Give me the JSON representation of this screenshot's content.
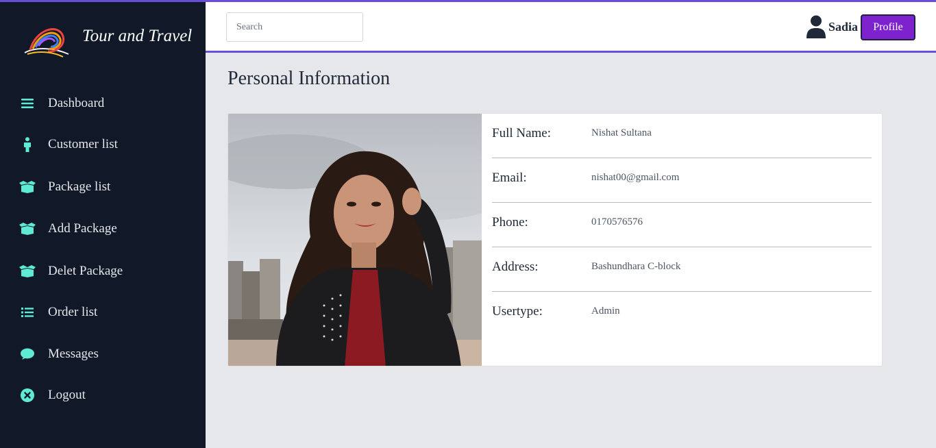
{
  "brand": {
    "title": "Tour and Travel"
  },
  "sidebar": {
    "items": [
      {
        "label": "Dashboard",
        "icon": "menu-bars-icon"
      },
      {
        "label": "Customer list",
        "icon": "person-icon"
      },
      {
        "label": "Package list",
        "icon": "box-open-icon"
      },
      {
        "label": "Add Package",
        "icon": "box-open-icon"
      },
      {
        "label": "Delet Package",
        "icon": "box-open-icon"
      },
      {
        "label": "Order list",
        "icon": "list-icon"
      },
      {
        "label": "Messages",
        "icon": "chat-bubble-icon"
      },
      {
        "label": "Logout",
        "icon": "close-circle-icon"
      }
    ]
  },
  "header": {
    "search_placeholder": "Search",
    "user_name": "Sadia",
    "profile_label": "Profile"
  },
  "main": {
    "title": "Personal Information",
    "fields": [
      {
        "label": "Full Name:",
        "value": "Nishat Sultana"
      },
      {
        "label": "Email:",
        "value": "nishat00@gmail.com"
      },
      {
        "label": "Phone:",
        "value": "0170576576"
      },
      {
        "label": "Address:",
        "value": "Bashundhara C-block"
      },
      {
        "label": "Usertype:",
        "value": "Admin"
      }
    ]
  },
  "colors": {
    "accent": "#6a4fd6",
    "sidebar_bg": "#111827",
    "icon_color": "#5eead4",
    "button_bg": "#7e22ce"
  }
}
